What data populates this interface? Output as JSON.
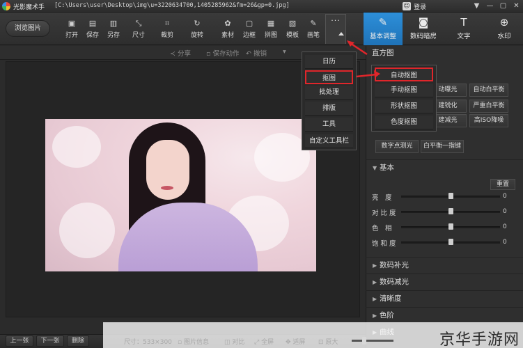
{
  "window": {
    "app_title": "光影魔术手",
    "file_path": "[C:\\Users\\user\\Desktop\\img\\u=3220634700,1405285962&fm=26&gp=0.jpg]",
    "login_label": "登录",
    "controls": [
      "▼",
      "—",
      "▢",
      "✕"
    ]
  },
  "toolbar": {
    "browse_label": "浏览图片",
    "tools": [
      {
        "label": "打开",
        "icon": "folder-open-icon",
        "glyph": "▣"
      },
      {
        "label": "保存",
        "icon": "save-icon",
        "glyph": "▤"
      },
      {
        "label": "另存",
        "icon": "save-as-icon",
        "glyph": "▥"
      },
      {
        "label": "尺寸",
        "icon": "resize-icon",
        "glyph": "⤡"
      },
      {
        "label": "裁剪",
        "icon": "crop-icon",
        "glyph": "⌗"
      },
      {
        "label": "旋转",
        "icon": "rotate-icon",
        "glyph": "↻"
      },
      {
        "label": "素材",
        "icon": "material-icon",
        "glyph": "✿"
      },
      {
        "label": "边框",
        "icon": "border-icon",
        "glyph": "▢"
      },
      {
        "label": "拼图",
        "icon": "collage-icon",
        "glyph": "▦"
      },
      {
        "label": "模板",
        "icon": "template-icon",
        "glyph": "▧"
      },
      {
        "label": "画笔",
        "icon": "brush-icon",
        "glyph": "✎"
      }
    ],
    "more_dots": "···",
    "tabs": [
      {
        "label": "基本调整",
        "icon": "edit-icon",
        "glyph": "✎",
        "active": true
      },
      {
        "label": "数码暗房",
        "icon": "camera-icon",
        "glyph": "◙"
      },
      {
        "label": "文字",
        "icon": "text-icon",
        "glyph": "T"
      },
      {
        "label": "水印",
        "icon": "watermark-icon",
        "glyph": "⊕"
      }
    ]
  },
  "subbar": {
    "share": "分享",
    "save_action": "保存动作",
    "undo": "撤销",
    "redo_arrow": "▾"
  },
  "more_menu": {
    "items": [
      "日历",
      "抠图",
      "批处理",
      "排版",
      "工具",
      "自定义工具栏"
    ],
    "highlighted": "抠图"
  },
  "cutout_menu": {
    "items": [
      "自动抠图",
      "手动抠图",
      "形状抠图",
      "色度抠图"
    ],
    "highlighted": "自动抠图"
  },
  "panel": {
    "histogram_title": "直方图",
    "quick_buttons": [
      "动曝光",
      "自动白平衡",
      "建锐化",
      "严重白平衡",
      "建减光",
      "高ISO降噪"
    ],
    "extra_buttons": [
      "数字点测光",
      "白平衡一指键"
    ],
    "basic": {
      "title": "基本",
      "reset_label": "重置",
      "sliders": [
        {
          "label": "亮　度",
          "value": 0,
          "fraction": 0.5
        },
        {
          "label": "对 比 度",
          "value": 0,
          "fraction": 0.5
        },
        {
          "label": "色　相",
          "value": 0,
          "fraction": 0.5
        },
        {
          "label": "饱 和 度",
          "value": 0,
          "fraction": 0.5
        }
      ]
    },
    "sections": [
      "数码补光",
      "数码减光",
      "清晰度",
      "色阶",
      "曲线"
    ]
  },
  "bottom": {
    "prev": "上一张",
    "next": "下一张",
    "delete": "删除",
    "size_label": "尺寸：533×300",
    "info": "图片信息",
    "compare": "对比",
    "fullscreen": "全屏",
    "fit": "适屏",
    "original": "原大"
  },
  "watermark": "京华手游网",
  "colors": {
    "accent": "#1f73b8",
    "highlight_box": "#e0262b"
  }
}
